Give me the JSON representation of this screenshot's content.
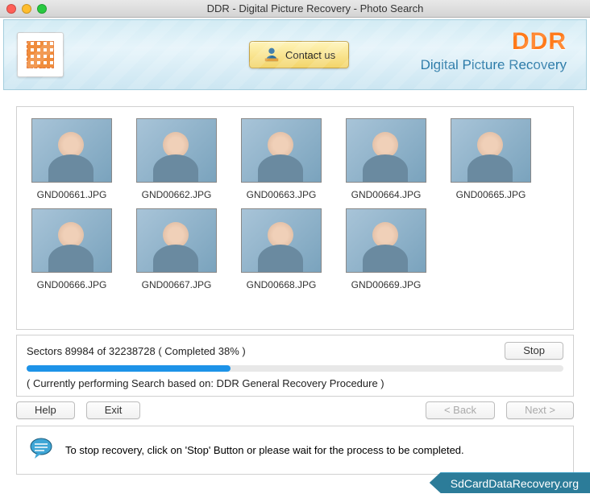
{
  "window": {
    "title": "DDR - Digital Picture Recovery - Photo Search"
  },
  "banner": {
    "contact_label": "Contact us",
    "brand_ddr": "DDR",
    "brand_sub": "Digital Picture Recovery"
  },
  "thumbnails": [
    {
      "label": "GND00661.JPG"
    },
    {
      "label": "GND00662.JPG"
    },
    {
      "label": "GND00663.JPG"
    },
    {
      "label": "GND00664.JPG"
    },
    {
      "label": "GND00665.JPG"
    },
    {
      "label": "GND00666.JPG"
    },
    {
      "label": "GND00667.JPG"
    },
    {
      "label": "GND00668.JPG"
    },
    {
      "label": "GND00669.JPG"
    }
  ],
  "progress": {
    "sectors_text": "Sectors 89984 of 32238728   ( Completed  38% )",
    "percent": 38,
    "status_text": "( Currently performing Search based on: DDR General Recovery Procedure )",
    "stop_label": "Stop"
  },
  "nav": {
    "help_label": "Help",
    "exit_label": "Exit",
    "back_label": "< Back",
    "next_label": "Next >"
  },
  "tip": {
    "text": "To stop recovery, click on 'Stop' Button or please wait for the process to be completed."
  },
  "footer": {
    "domain": "SdCardDataRecovery.org"
  }
}
